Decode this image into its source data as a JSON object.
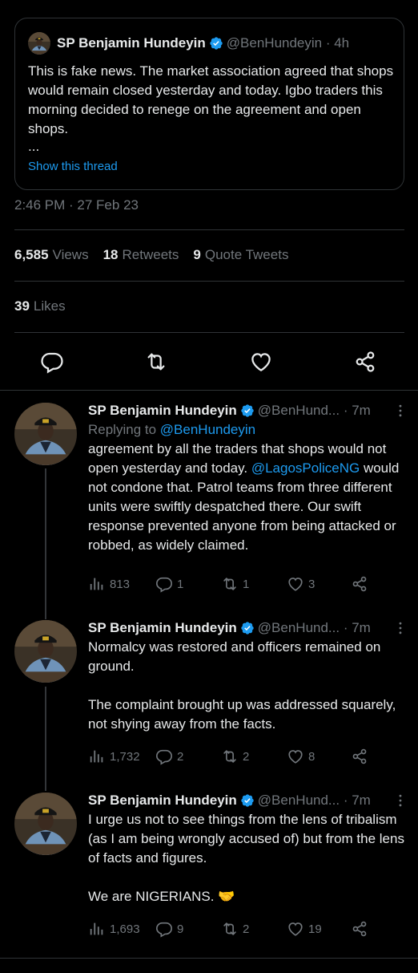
{
  "quoted_tweet": {
    "author_name": "SP Benjamin Hundeyin",
    "handle_time": "@BenHundeyin · 4h",
    "text": "This is fake news. The market association agreed that shops would remain closed yesterday and today. Igbo traders this morning decided to renege on the agreement and open shops.",
    "ellipsis": "...",
    "show_thread": "Show this thread"
  },
  "timestamp": "2:46 PM · 27 Feb 23",
  "stats": {
    "views_count": "6,585",
    "views_label": "Views",
    "retweets_count": "18",
    "retweets_label": "Retweets",
    "quotes_count": "9",
    "quotes_label": "Quote Tweets",
    "likes_count": "39",
    "likes_label": "Likes"
  },
  "action_icons": [
    "reply-icon",
    "retweet-icon",
    "like-icon",
    "share-icon"
  ],
  "colors": {
    "background": "#000000",
    "text": "#e7e9ea",
    "muted": "#71767b",
    "accent": "#1d9bf0",
    "verified": "#1d9bf0",
    "divider": "#2f3336"
  },
  "replies": [
    {
      "author_name": "SP Benjamin Hundeyin",
      "handle_time": "@BenHund... · 7m",
      "replying_prefix": "Replying to ",
      "replying_to": "@BenHundeyin",
      "text_1": "agreement by all the traders that shops would not open yesterday and today. ",
      "mention": "@LagosPoliceNG",
      "text_2": " would not condone that. Patrol teams from three different units were swiftly despatched there. Our swift response prevented anyone from being attacked or robbed, as widely claimed.",
      "views": "813",
      "replies": "1",
      "retweets": "1",
      "likes": "3"
    },
    {
      "author_name": "SP Benjamin Hundeyin",
      "handle_time": "@BenHund... · 7m",
      "paragraph_1": "Normalcy was restored and officers remained on ground.",
      "paragraph_2": "The complaint brought up was addressed squarely, not shying away from the facts.",
      "views": "1,732",
      "replies": "2",
      "retweets": "2",
      "likes": "8"
    },
    {
      "author_name": "SP Benjamin Hundeyin",
      "handle_time": "@BenHund... · 7m",
      "paragraph_1": "I urge us not to see things from the lens of tribalism (as I am being wrongly accused of) but from the lens of facts and figures.",
      "paragraph_2": "We are NIGERIANS. 🤝",
      "views": "1,693",
      "replies": "9",
      "retweets": "2",
      "likes": "19"
    }
  ]
}
